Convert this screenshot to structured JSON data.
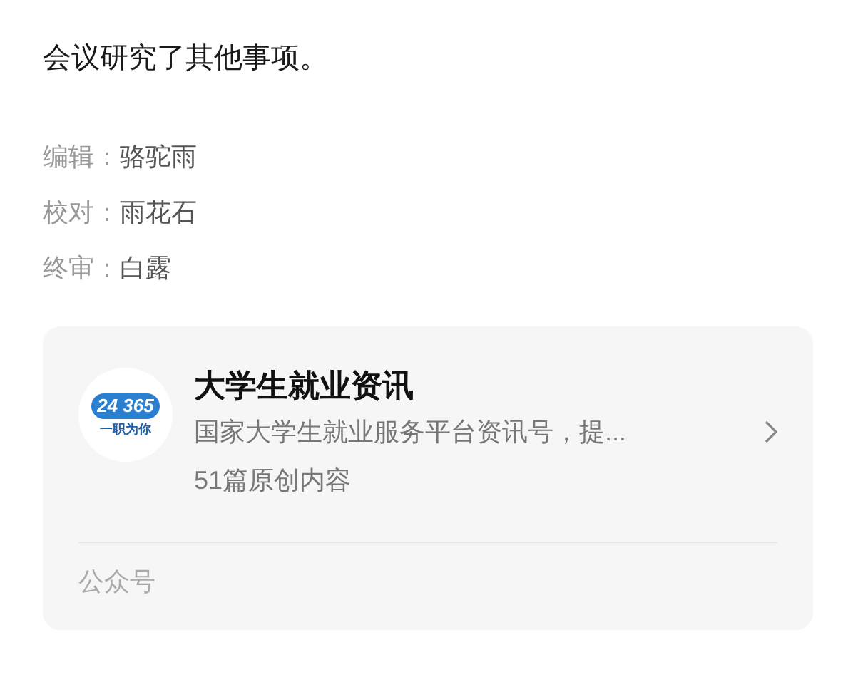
{
  "paragraph": "会议研究了其他事项。",
  "credits": [
    {
      "label": "编辑：",
      "name": "骆驼雨"
    },
    {
      "label": "校对：",
      "name": "雨花石"
    },
    {
      "label": "终审：",
      "name": "白露"
    }
  ],
  "account_card": {
    "logo": {
      "number": "24 365",
      "slogan": "一职为你"
    },
    "name": "大学生就业资讯",
    "description": "国家大学生就业服务平台资讯号，提...",
    "count": "51篇原创内容",
    "footer": "公众号"
  }
}
